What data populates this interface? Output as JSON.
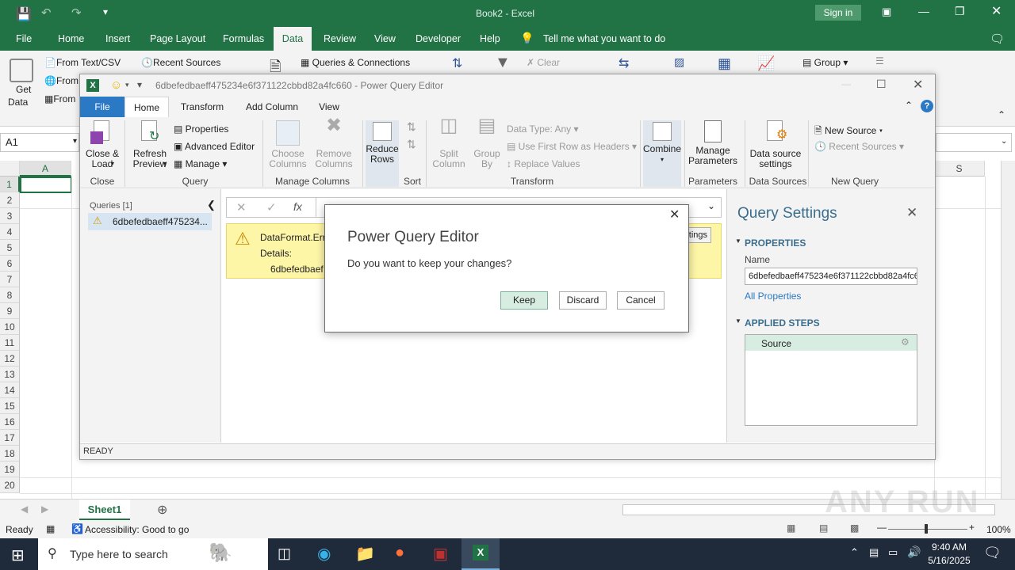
{
  "excel": {
    "title": "Book2  -  Excel",
    "sign_in": "Sign in",
    "tabs": [
      "File",
      "Home",
      "Insert",
      "Page Layout",
      "Formulas",
      "Data",
      "Review",
      "View",
      "Developer",
      "Help"
    ],
    "tell_me": "Tell me what you want to do",
    "ribbon": {
      "from_text_csv": "From Text/CSV",
      "recent_sources": "Recent Sources",
      "queries_connections": "Queries & Connections",
      "clear": "Clear",
      "group": "Group",
      "get_data_1": "Get",
      "get_data_2": "Data",
      "from_1": "From",
      "from_2": "From"
    },
    "name_box": "A1",
    "columns": [
      "A",
      "S"
    ],
    "rows": [
      "1",
      "2",
      "3",
      "4",
      "5",
      "6",
      "7",
      "8",
      "9",
      "10",
      "11",
      "12",
      "13",
      "14",
      "15",
      "16",
      "17",
      "18",
      "19",
      "20"
    ],
    "sheet_tab": "Sheet1",
    "status_ready": "Ready",
    "accessibility": "Accessibility: Good to go",
    "zoom": "100%"
  },
  "pq": {
    "title": "6dbefedbaeff475234e6f371122cbbd82a4fc660 - Power Query Editor",
    "tabs": [
      "File",
      "Home",
      "Transform",
      "Add Column",
      "View"
    ],
    "ribbon": {
      "close_load": [
        "Close &",
        "Load"
      ],
      "refresh_preview": [
        "Refresh",
        "Preview"
      ],
      "properties": "Properties",
      "advanced_editor": "Advanced Editor",
      "manage": "Manage",
      "choose_columns": [
        "Choose",
        "Columns"
      ],
      "remove_columns": [
        "Remove",
        "Columns"
      ],
      "reduce_rows": [
        "Reduce",
        "Rows"
      ],
      "split_column": [
        "Split",
        "Column"
      ],
      "group_by": [
        "Group",
        "By"
      ],
      "data_type": "Data Type: Any",
      "use_first_row": "Use First Row as Headers",
      "replace_values": "Replace Values",
      "combine": "Combine",
      "manage_parameters": [
        "Manage",
        "Parameters"
      ],
      "data_source_settings": [
        "Data source",
        "settings"
      ],
      "new_source": "New Source",
      "recent_sources": "Recent Sources",
      "groups": {
        "close": "Close",
        "query": "Query",
        "manage_columns": "Manage Columns",
        "sort": "Sort",
        "transform": "Transform",
        "parameters": "Parameters",
        "data_sources": "Data Sources",
        "new_query": "New Query"
      }
    },
    "queries_header": "Queries [1]",
    "query_item": "6dbefedbaeff475234...",
    "error_title": "DataFormat.Erro",
    "error_details": "Details:",
    "error_detail_value": "6dbefedbaef",
    "edit_settings_partial": "ttings",
    "settings": {
      "title": "Query Settings",
      "properties": "PROPERTIES",
      "name_label": "Name",
      "name_value": "6dbefedbaeff475234e6f371122cbbd82a4fc660",
      "all_properties": "All Properties",
      "applied_steps": "APPLIED STEPS",
      "steps": [
        "Source"
      ]
    },
    "status": "READY"
  },
  "dialog": {
    "title": "Power Query Editor",
    "message": "Do you want to keep your changes?",
    "keep": "Keep",
    "discard": "Discard",
    "cancel": "Cancel"
  },
  "taskbar": {
    "search_placeholder": "Type here to search",
    "time": "9:40 AM",
    "date": "5/16/2025"
  },
  "watermark": "ANY RUN",
  "colors": {
    "excel_green": "#217346",
    "pq_file_blue": "#2b78c5",
    "error_yellow": "#fef6a7",
    "step_selected": "#d7ede1"
  }
}
